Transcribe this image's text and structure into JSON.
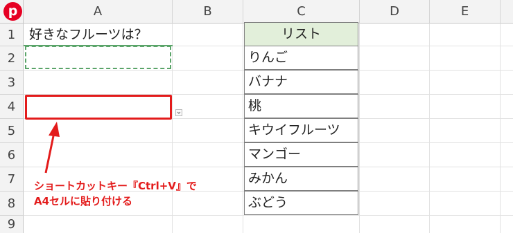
{
  "columns": [
    "A",
    "B",
    "C",
    "D",
    "E"
  ],
  "rows": [
    "1",
    "2",
    "3",
    "4",
    "5",
    "6",
    "7",
    "8",
    "9"
  ],
  "cells": {
    "a1": "好きなフルーツは？"
  },
  "list": {
    "header": "リスト",
    "items": [
      "りんご",
      "バナナ",
      "桃",
      "キウイフルーツ",
      "マンゴー",
      "みかん",
      "ぶどう"
    ]
  },
  "annotation": {
    "line1": "ショートカットキー『Ctrl+V』で",
    "line2": "A4セルに貼り付ける"
  },
  "badge": {
    "label": "p",
    "color": "#e60023"
  },
  "colors": {
    "selection_red": "#e31b1b",
    "list_header_fill": "#e2efda",
    "copy_marquee": "#5aa469"
  }
}
